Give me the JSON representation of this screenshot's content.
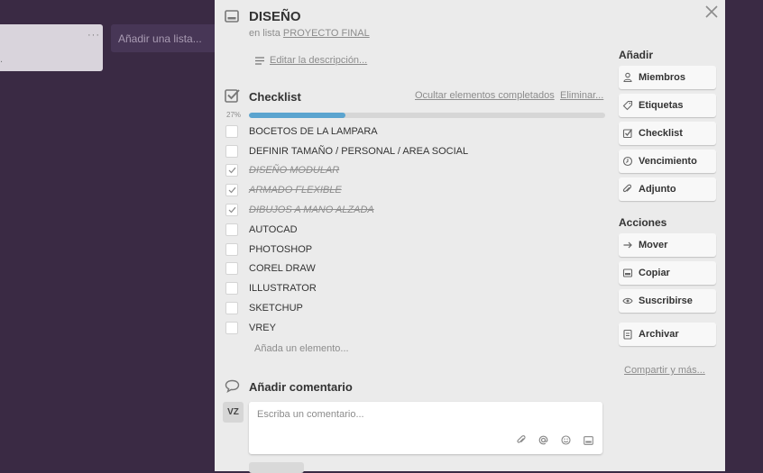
{
  "board": {
    "list_menu": "···",
    "add_list_label": "Añadir una lista..."
  },
  "card": {
    "title": "DISEÑO",
    "in_list_prefix": "en lista",
    "list_name": "PROYECTO FINAL",
    "edit_description": "Editar la descripción..."
  },
  "checklist": {
    "title": "Checklist",
    "hide_completed": "Ocultar elementos completados",
    "delete": "Eliminar...",
    "percent_label": "27%",
    "progress": 0.27,
    "items": [
      {
        "text": "BOCETOS DE LA LAMPARA",
        "done": false
      },
      {
        "text": "DEFINIR TAMAÑO / PERSONAL / AREA SOCIAL",
        "done": false
      },
      {
        "text": "DISEÑO MODULAR",
        "done": true
      },
      {
        "text": "ARMADO FLEXIBLE",
        "done": true
      },
      {
        "text": "DIBUJOS A MANO ALZADA",
        "done": true
      },
      {
        "text": "AUTOCAD",
        "done": false
      },
      {
        "text": "PHOTOSHOP",
        "done": false
      },
      {
        "text": "COREL DRAW",
        "done": false
      },
      {
        "text": "ILLUSTRATOR",
        "done": false
      },
      {
        "text": "SKETCHUP",
        "done": false
      },
      {
        "text": "VREY",
        "done": false
      }
    ],
    "add_item": "Añada un elemento..."
  },
  "comment": {
    "title": "Añadir comentario",
    "avatar_initials": "VZ",
    "placeholder": "Escriba un comentario...",
    "tool_icons": [
      "paperclip-icon",
      "at-icon",
      "emoji-icon",
      "card-icon"
    ]
  },
  "sidebar": {
    "add_heading": "Añadir",
    "add_buttons": [
      {
        "label": "Miembros",
        "icon": "person-icon"
      },
      {
        "label": "Etiquetas",
        "icon": "tag-icon"
      },
      {
        "label": "Checklist",
        "icon": "checkbox-icon"
      },
      {
        "label": "Vencimiento",
        "icon": "clock-icon"
      },
      {
        "label": "Adjunto",
        "icon": "paperclip-icon"
      }
    ],
    "actions_heading": "Acciones",
    "action_buttons": [
      {
        "label": "Mover",
        "icon": "arrow-right-icon"
      },
      {
        "label": "Copiar",
        "icon": "copy-icon"
      },
      {
        "label": "Suscribirse",
        "icon": "eye-icon"
      },
      {
        "label": "Archivar",
        "icon": "archive-icon"
      }
    ],
    "share_link": "Compartir y más..."
  },
  "colors": {
    "board_bg": "#3a2a44",
    "modal_bg": "#ebebeb",
    "progress_fill": "#5ba4cf"
  }
}
